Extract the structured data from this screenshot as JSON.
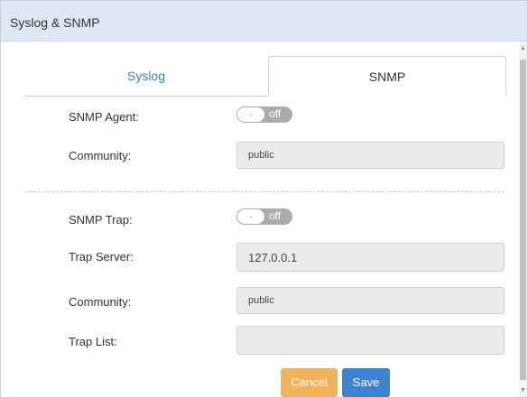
{
  "dialog": {
    "title": "Syslog & SNMP"
  },
  "tabs": [
    {
      "label": "Syslog",
      "active": false
    },
    {
      "label": "SNMP",
      "active": true
    }
  ],
  "snmp_agent": {
    "label": "SNMP Agent:",
    "toggle_knob": ".",
    "toggle_state": "off"
  },
  "community1": {
    "label": "Community:",
    "value": "public"
  },
  "snmp_trap": {
    "label": "SNMP Trap:",
    "toggle_knob": ".",
    "toggle_state": "off"
  },
  "trap_server": {
    "label": "Trap Server:",
    "value": "127.0.0.1"
  },
  "community2": {
    "label": "Community:",
    "value": "public"
  },
  "trap_list": {
    "label": "Trap List:",
    "value": ""
  },
  "buttons": {
    "cancel": "Cancel",
    "save": "Save"
  },
  "colors": {
    "header_bg": "#dfe9f6",
    "active_tab_text": "#3a7fcc",
    "cancel_button": "#f0b35c",
    "save_button": "#3f82d1",
    "toggle_off": "#ababab"
  },
  "icons": {
    "scroll_up": "scroll-up-arrow-icon",
    "scroll_down": "scroll-down-arrow-icon"
  }
}
